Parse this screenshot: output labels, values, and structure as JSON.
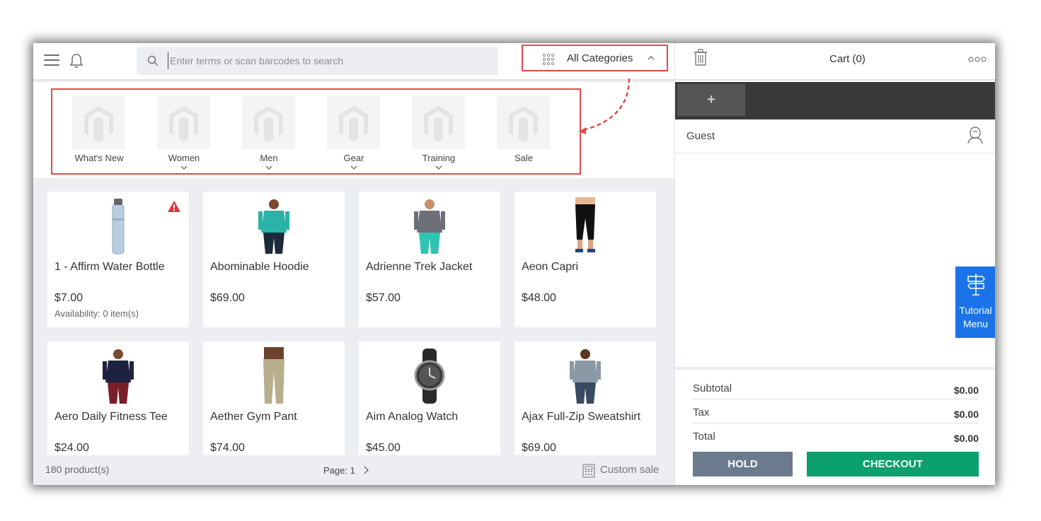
{
  "search": {
    "placeholder": "Enter terms or scan barcodes to search"
  },
  "category_selector": {
    "label": "All Categories"
  },
  "categories": [
    {
      "label": "What's New",
      "has_children": false
    },
    {
      "label": "Women",
      "has_children": true
    },
    {
      "label": "Men",
      "has_children": true
    },
    {
      "label": "Gear",
      "has_children": true
    },
    {
      "label": "Training",
      "has_children": true
    },
    {
      "label": "Sale",
      "has_children": false
    }
  ],
  "products": [
    {
      "name": "1 - Affirm Water Bottle",
      "price": "$7.00",
      "availability": "Availability: 0 item(s)",
      "warning": true,
      "image": "water-bottle"
    },
    {
      "name": "Abominable Hoodie",
      "price": "$69.00",
      "image": "hoodie"
    },
    {
      "name": "Adrienne Trek Jacket",
      "price": "$57.00",
      "image": "jacket"
    },
    {
      "name": "Aeon Capri",
      "price": "$48.00",
      "image": "capri"
    },
    {
      "name": "Aero Daily Fitness Tee",
      "price": "$24.00",
      "image": "tee"
    },
    {
      "name": "Aether Gym Pant",
      "price": "$74.00",
      "image": "pant"
    },
    {
      "name": "Aim Analog Watch",
      "price": "$45.00",
      "image": "watch"
    },
    {
      "name": "Ajax Full-Zip Sweatshirt",
      "price": "$69.00",
      "image": "sweatshirt"
    }
  ],
  "footer": {
    "product_count": "180 product(s)",
    "page": "Page: 1",
    "custom_sale": "Custom sale"
  },
  "cart": {
    "title": "Cart (0)",
    "add_tab": "+",
    "customer": "Guest",
    "tutorial": {
      "line1": "Tutorial",
      "line2": "Menu"
    },
    "totals": [
      {
        "label": "Subtotal",
        "value": "$0.00"
      },
      {
        "label": "Tax",
        "value": "$0.00"
      },
      {
        "label": "Total",
        "value": "$0.00"
      }
    ],
    "hold_label": "HOLD",
    "checkout_label": "CHECKOUT"
  },
  "colors": {
    "highlight": "#e34a4a",
    "checkout": "#0ba06e",
    "hold": "#6c7a8e",
    "tutorial": "#1a73e8",
    "warning": "#e8333a"
  }
}
